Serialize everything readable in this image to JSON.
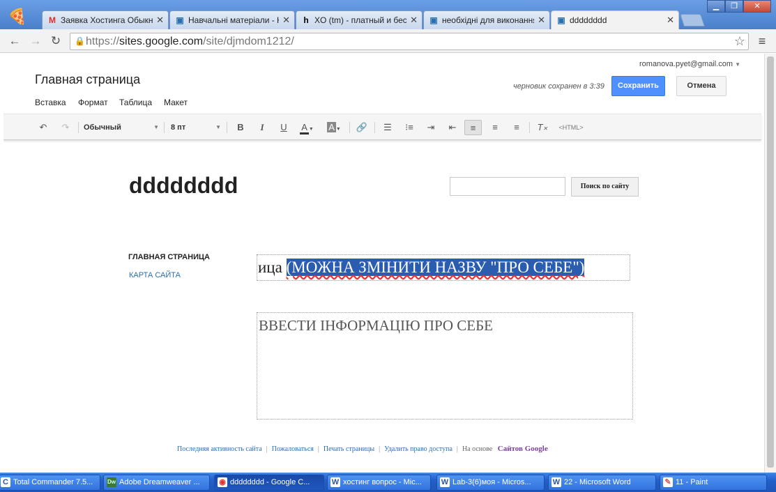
{
  "browser": {
    "tabs": [
      {
        "icon": "gmail-icon",
        "glyph": "M",
        "label": "Заявка Хостинга Обыкно"
      },
      {
        "icon": "google-sites-icon",
        "glyph": "▣",
        "label": "Навчальні матеріали - Ког"
      },
      {
        "icon": "hostinger-icon",
        "glyph": "h",
        "label": "XO (tm) - платный и беспл"
      },
      {
        "icon": "google-sites-icon",
        "glyph": "▣",
        "label": "необхідні для виконання"
      },
      {
        "icon": "google-sites-icon",
        "glyph": "▣",
        "label": "dddddddd"
      }
    ],
    "url_scheme": "https://",
    "url_host": "sites.google.com",
    "url_path": "/site/djmdom1212/"
  },
  "header": {
    "user_email": "romanova.pyet@gmail.com",
    "page_title": "Главная страница",
    "menu": [
      "Вставка",
      "Формат",
      "Таблица",
      "Макет"
    ],
    "draft_status": "черновик сохранен в 3:39",
    "save_label": "Сохранить",
    "cancel_label": "Отмена"
  },
  "editor_toolbar": {
    "style_select": "Обычный",
    "size_select": "8 пт",
    "html_label": "<HTML>"
  },
  "site": {
    "title": "dddddddd",
    "search_button": "Поиск по сайту",
    "nav": [
      "ГЛАВНАЯ СТРАНИЦА",
      "КАРТА САЙТА"
    ],
    "heading_prefix": "ица ",
    "heading_selected": "(МОЖНА ЗМІНИТИ НАЗВУ \"ПРО СЕБЕ\")",
    "body_text": "ВВЕСТИ ІНФОРМАЦІЮ ПРО СЕБЕ"
  },
  "footer": {
    "links": [
      "Последняя активность сайта",
      "Пожаловаться",
      "Печать страницы",
      "Удалить право доступа"
    ],
    "powered_by": "На основе",
    "brand": "Сайтов Google"
  },
  "taskbar": [
    {
      "icon": "total-commander-icon",
      "glyph": "C",
      "label": "Total Commander 7.5..."
    },
    {
      "icon": "dreamweaver-icon",
      "glyph": "Dw",
      "label": "Adobe Dreamweaver ..."
    },
    {
      "icon": "chrome-icon",
      "glyph": "◉",
      "label": "dddddddd - Google C..."
    },
    {
      "icon": "word-icon",
      "glyph": "W",
      "label": "хостинг вопрос - Mic..."
    },
    {
      "icon": "word-icon",
      "glyph": "W",
      "label": "Lab-3(6)моя - Micros..."
    },
    {
      "icon": "word-icon",
      "glyph": "W",
      "label": "22 - Microsoft Word"
    },
    {
      "icon": "paint-icon",
      "glyph": "✎",
      "label": "11 - Paint"
    }
  ]
}
